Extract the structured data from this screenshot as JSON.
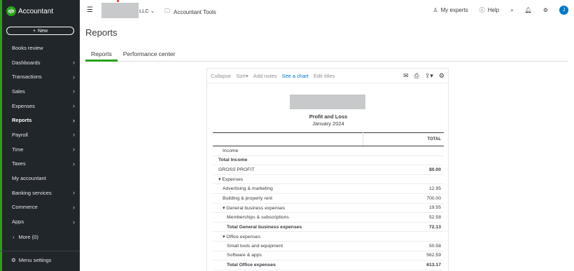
{
  "app": {
    "logo_mark": "qb",
    "logo_text": "Accountant",
    "new_button": "New",
    "company_suffix": "LLC",
    "accountant_tools": "Accountant Tools",
    "my_experts": "My experts",
    "help": "Help",
    "avatar_initial": "J"
  },
  "sidebar": {
    "items": [
      {
        "label": "Books review",
        "chevron": false
      },
      {
        "label": "Dashboards",
        "chevron": true
      },
      {
        "label": "Transactions",
        "chevron": true
      },
      {
        "label": "Sales",
        "chevron": true
      },
      {
        "label": "Expenses",
        "chevron": true
      },
      {
        "label": "Reports",
        "chevron": true,
        "active": true
      },
      {
        "label": "Payroll",
        "chevron": true
      },
      {
        "label": "Time",
        "chevron": true
      },
      {
        "label": "Taxes",
        "chevron": true
      },
      {
        "label": "My accountant",
        "chevron": false
      },
      {
        "label": "Banking services",
        "chevron": true
      },
      {
        "label": "Commerce",
        "chevron": true
      },
      {
        "label": "Apps",
        "chevron": true
      }
    ],
    "more": "More (0)",
    "menu_settings": "Menu settings"
  },
  "page": {
    "title": "Reports",
    "tabs": [
      "Reports",
      "Performance center"
    ]
  },
  "report": {
    "toolbar": {
      "collapse": "Collapse",
      "sort": "Sort",
      "add_notes": "Add notes",
      "see_chart": "See a chart",
      "edit_titles": "Edit titles"
    },
    "title": "Profit and Loss",
    "date": "January 2024",
    "column_header": "TOTAL",
    "rows": [
      {
        "label": "Income",
        "amount": "",
        "indent": 1,
        "bold": false
      },
      {
        "label": "Total Income",
        "amount": "",
        "indent": 0,
        "bold": true
      },
      {
        "label": "GROSS PROFIT",
        "amount": "$0.00",
        "indent": 0,
        "bold": false,
        "bold_amount": true
      },
      {
        "label": "▾ Expenses",
        "amount": "",
        "indent": 0,
        "bold": false
      },
      {
        "label": "Advertising & marketing",
        "amount": "12.95",
        "indent": 1,
        "bold": false
      },
      {
        "label": "Building & property rent",
        "amount": "700.00",
        "indent": 1,
        "bold": false
      },
      {
        "label": "▾ General business expenses",
        "amount": "19.55",
        "indent": 1,
        "bold": false
      },
      {
        "label": "Memberships & subscriptions",
        "amount": "52.58",
        "indent": 2,
        "bold": false
      },
      {
        "label": "Total General business expenses",
        "amount": "72.13",
        "indent": 2,
        "bold": true,
        "total": true
      },
      {
        "label": "▾ Office expenses",
        "amount": "",
        "indent": 1,
        "bold": false
      },
      {
        "label": "Small tools and equipment",
        "amount": "50.58",
        "indent": 2,
        "bold": false
      },
      {
        "label": "Software & apps",
        "amount": "562.59",
        "indent": 2,
        "bold": false
      },
      {
        "label": "Total Office expenses",
        "amount": "613.17",
        "indent": 2,
        "bold": true,
        "total": true
      }
    ]
  },
  "colors": {
    "sidebar_bg": "#21262a",
    "brand_green": "#2ca01c",
    "link_blue": "#0077c5"
  }
}
